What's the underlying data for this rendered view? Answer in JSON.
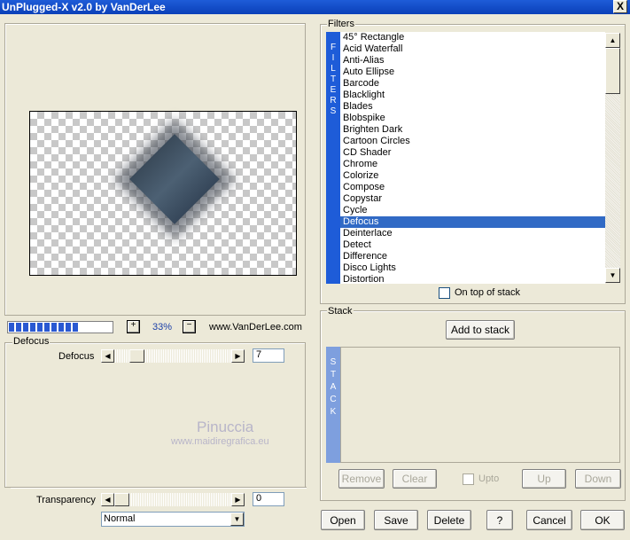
{
  "window": {
    "title": "UnPlugged-X v2.0 by VanDerLee",
    "close_label": "X"
  },
  "preview": {
    "zoom": "33%",
    "zoom_in_label": "+",
    "zoom_out_label": "−",
    "site": "www.VanDerLee.com",
    "progress_segments": 10
  },
  "filter_settings": {
    "group_title": "Defocus",
    "defocus": {
      "label": "Defocus",
      "value": "7"
    },
    "transparency": {
      "label": "Transparency",
      "value": "0"
    },
    "blend_mode": {
      "selected": "Normal"
    }
  },
  "watermark": {
    "name": "Pinuccia",
    "url": "www.maidiregrafica.eu"
  },
  "filters": {
    "title": "Filters",
    "sidebar_letters": [
      "F",
      "I",
      "L",
      "T",
      "E",
      "R",
      "S"
    ],
    "items": [
      "45° Rectangle",
      "Acid Waterfall",
      "Anti-Alias",
      "Auto Ellipse",
      "Barcode",
      "Blacklight",
      "Blades",
      "Blobspike",
      "Brighten Dark",
      "Cartoon Circles",
      "CD Shader",
      "Chrome",
      "Colorize",
      "Compose",
      "Copystar",
      "Cycle",
      "Defocus",
      "Deinterlace",
      "Detect",
      "Difference",
      "Disco Lights",
      "Distortion"
    ],
    "selected": "Defocus",
    "on_top_label": "On top of stack"
  },
  "stack": {
    "title": "Stack",
    "sidebar_letters": [
      "S",
      "T",
      "A",
      "C",
      "K"
    ],
    "add_label": "Add to stack",
    "remove_label": "Remove",
    "clear_label": "Clear",
    "upto_label": "Upto",
    "up_label": "Up",
    "down_label": "Down"
  },
  "buttons": {
    "open": "Open",
    "save": "Save",
    "delete": "Delete",
    "help": "?",
    "cancel": "Cancel",
    "ok": "OK"
  },
  "colors": {
    "titlebar": "#0a3fb8",
    "selection": "#316ac5",
    "filters_bar": "#1e5cd8",
    "stack_bar": "#7e9fde"
  }
}
